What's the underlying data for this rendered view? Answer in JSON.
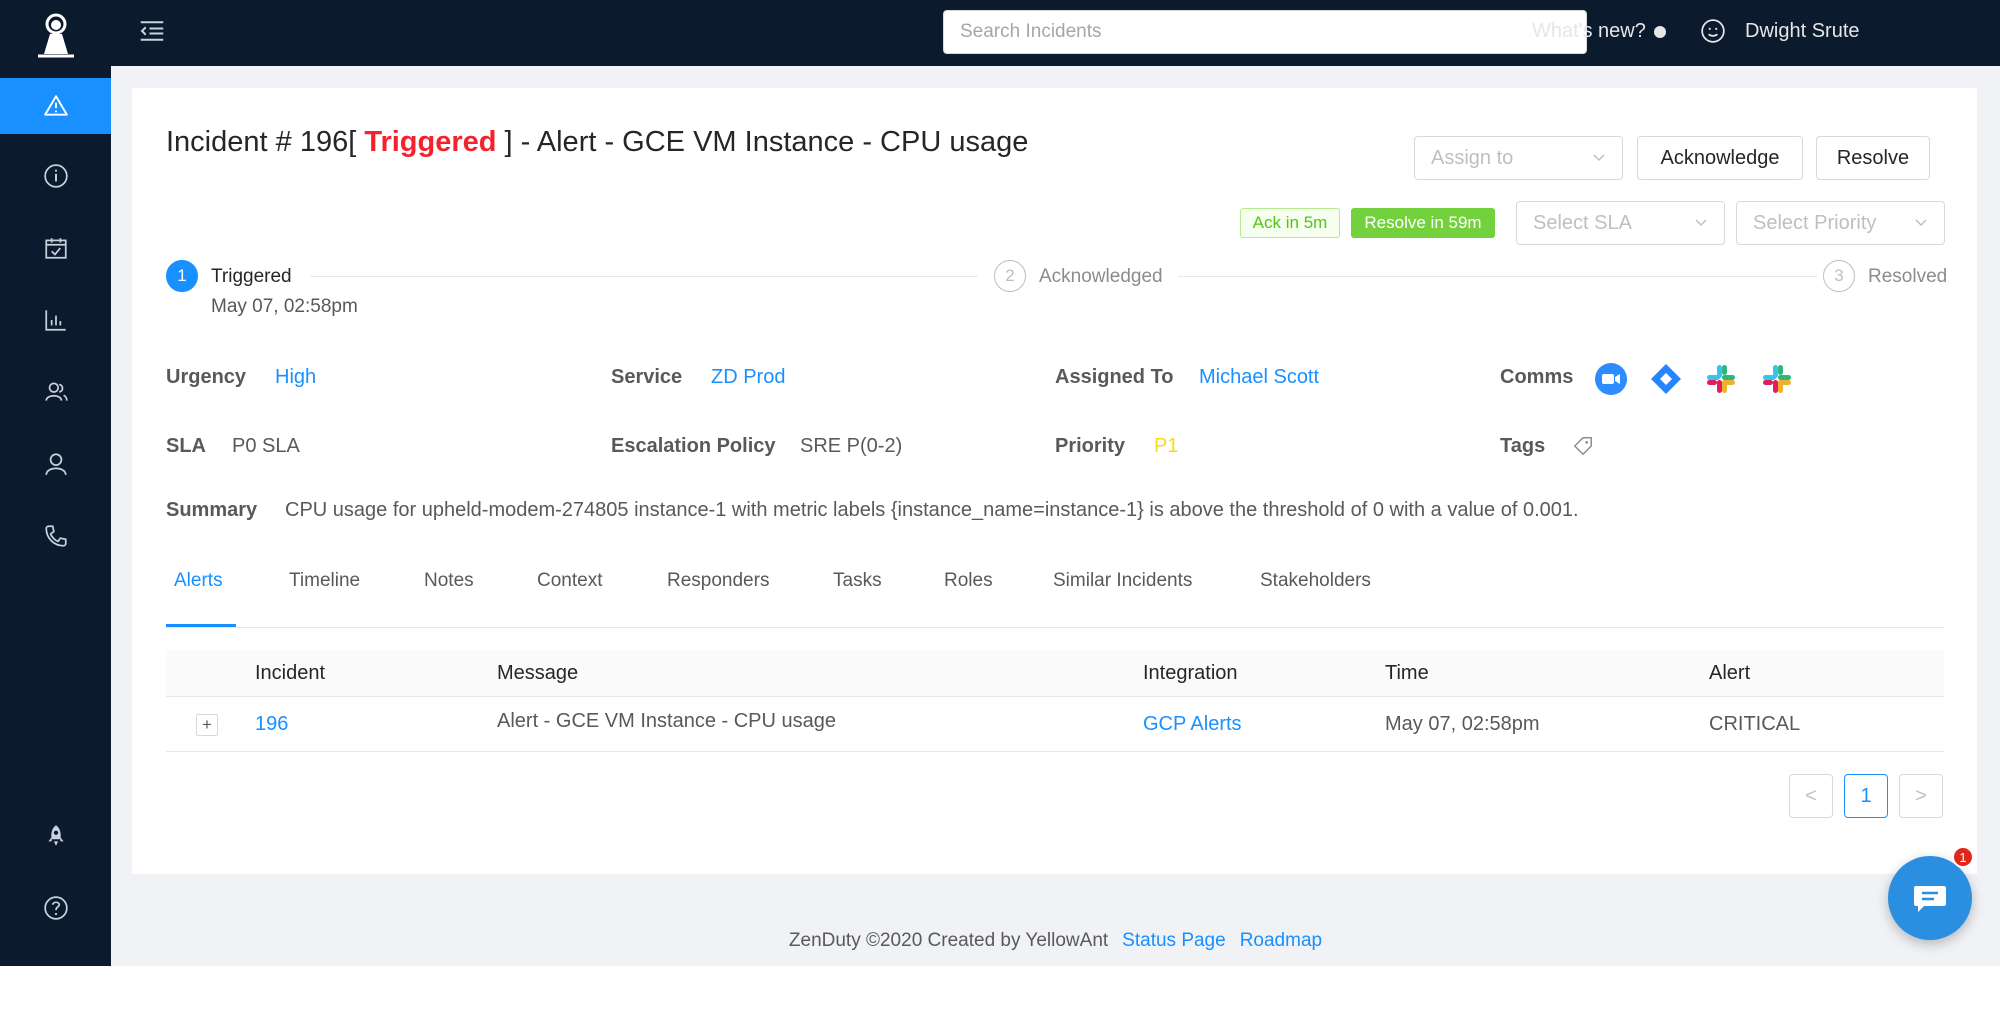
{
  "topbar": {
    "search_placeholder": "Search Incidents",
    "whats_new": "What's new?",
    "user_name": "Dwight Srute"
  },
  "sidebar": {
    "items": [
      {
        "icon": "alert-triangle-icon",
        "active": true
      },
      {
        "icon": "info-icon",
        "active": false
      },
      {
        "icon": "calendar-check-icon",
        "active": false
      },
      {
        "icon": "bar-chart-icon",
        "active": false
      },
      {
        "icon": "team-icon",
        "active": false
      },
      {
        "icon": "user-icon",
        "active": false
      },
      {
        "icon": "phone-icon",
        "active": false
      },
      {
        "icon": "rocket-icon",
        "active": false
      },
      {
        "icon": "help-icon",
        "active": false
      }
    ]
  },
  "incident": {
    "title_prefix": "Incident # 196[",
    "status": "Triggered",
    "title_suffix": "] - Alert - GCE VM Instance - CPU usage"
  },
  "actions": {
    "assign_placeholder": "Assign to",
    "acknowledge": "Acknowledge",
    "resolve": "Resolve",
    "ack_sla": "Ack in 5m",
    "resolve_sla": "Resolve in 59m",
    "sla_placeholder": "Select SLA",
    "priority_placeholder": "Select Priority"
  },
  "steps": [
    {
      "num": "1",
      "label": "Triggered",
      "time": "May 07, 02:58pm"
    },
    {
      "num": "2",
      "label": "Acknowledged"
    },
    {
      "num": "3",
      "label": "Resolved"
    }
  ],
  "details": {
    "urgency_label": "Urgency",
    "urgency": "High",
    "service_label": "Service",
    "service": "ZD Prod",
    "assigned_label": "Assigned To",
    "assigned": "Michael Scott",
    "comms_label": "Comms",
    "sla_label": "SLA",
    "sla": "P0 SLA",
    "escalation_label": "Escalation Policy",
    "escalation": "SRE P(0-2)",
    "priority_label": "Priority",
    "priority": "P1",
    "tags_label": "Tags",
    "summary_label": "Summary",
    "summary": "CPU usage for upheld-modem-274805 instance-1 with metric labels {instance_name=instance-1} is above the threshold of 0 with a value of 0.001."
  },
  "tabs": [
    "Alerts",
    "Timeline",
    "Notes",
    "Context",
    "Responders",
    "Tasks",
    "Roles",
    "Similar Incidents",
    "Stakeholders"
  ],
  "table": {
    "headers": [
      "Incident",
      "Message",
      "Integration",
      "Time",
      "Alert"
    ],
    "rows": [
      {
        "expand": "+",
        "incident": "196",
        "message": "Alert - GCE VM Instance - CPU usage",
        "integration": "GCP Alerts",
        "time": "May 07, 02:58pm",
        "alert": "CRITICAL"
      }
    ]
  },
  "pagination": {
    "prev": "<",
    "current": "1",
    "next": ">"
  },
  "chat": {
    "badge": "1"
  },
  "footer": {
    "text": "ZenDuty ©2020 Created by YellowAnt",
    "status_page": "Status Page",
    "roadmap": "Roadmap"
  },
  "colors": {
    "sidebar_bg": "#0c1a2e",
    "accent": "#1890ff",
    "triggered": "#f5222d",
    "priority_p1": "#fadb14"
  }
}
